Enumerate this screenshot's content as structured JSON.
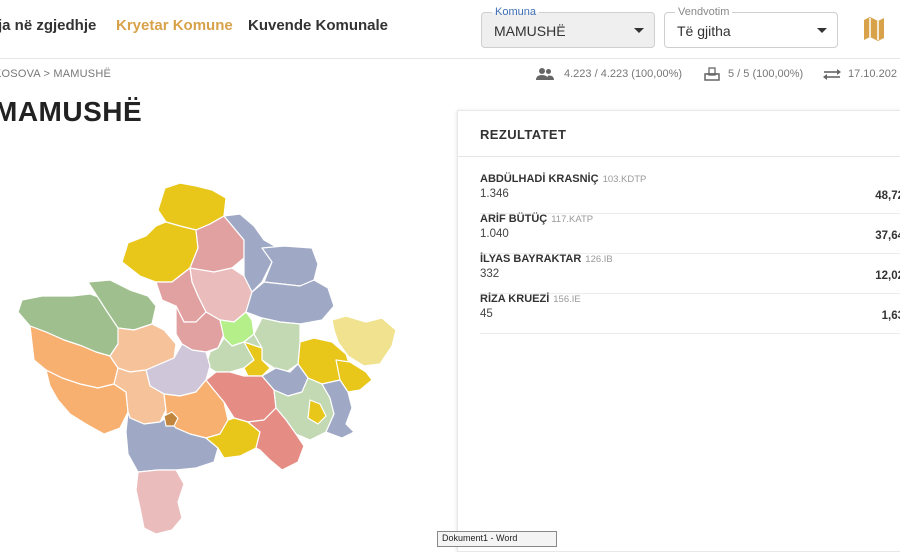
{
  "nav": {
    "tab1_label": "ja në zgjedhje",
    "tab2_label": "Kryetar Komune",
    "tab3_label": "Kuvende Komunale"
  },
  "filters": {
    "komuna": {
      "legend": "Komuna",
      "value": "MAMUSHË"
    },
    "vendvotim": {
      "legend": "Vendvotim",
      "value": "Të gjitha"
    }
  },
  "breadcrumb": "KOSOVA > MAMUSHË",
  "stats": {
    "voters": "4.223 / 4.223 (100,00%)",
    "stations": "5 / 5 (100,00%)",
    "date": "17.10.202"
  },
  "page_title": "MAMUSHË",
  "results": {
    "title": "REZULTATET",
    "candidates": [
      {
        "name": "ABDÜLHADİ KRASNİÇ",
        "party": "103.KDTP",
        "votes": "1.346",
        "pct": "48,72"
      },
      {
        "name": "ARİF BÜTÜÇ",
        "party": "117.KATP",
        "votes": "1.040",
        "pct": "37,64"
      },
      {
        "name": "İLYAS BAYRAKTAR",
        "party": "126.IB",
        "votes": "332",
        "pct": "12,02"
      },
      {
        "name": "RİZA KRUEZİ",
        "party": "156.IE",
        "votes": "45",
        "pct": "1,63"
      }
    ]
  },
  "tooltip": "Dokument1 - Word",
  "colors": {
    "accent": "#d8a24a",
    "legend_blue": "#3f6fb5",
    "yellow": "#e8c61a",
    "light_yellow": "#f0e28e",
    "blue_grey": "#9fa9c6",
    "pink": "#e2a1a1",
    "light_pink": "#ebbcbc",
    "green": "#9fc08e",
    "light_green": "#c2d9b3",
    "lime": "#b4ef8a",
    "orange": "#f7b070",
    "peach": "#f6c29a",
    "lilac": "#cfc7d9",
    "salmon": "#e58d84",
    "mamushe": "#c1853d"
  }
}
